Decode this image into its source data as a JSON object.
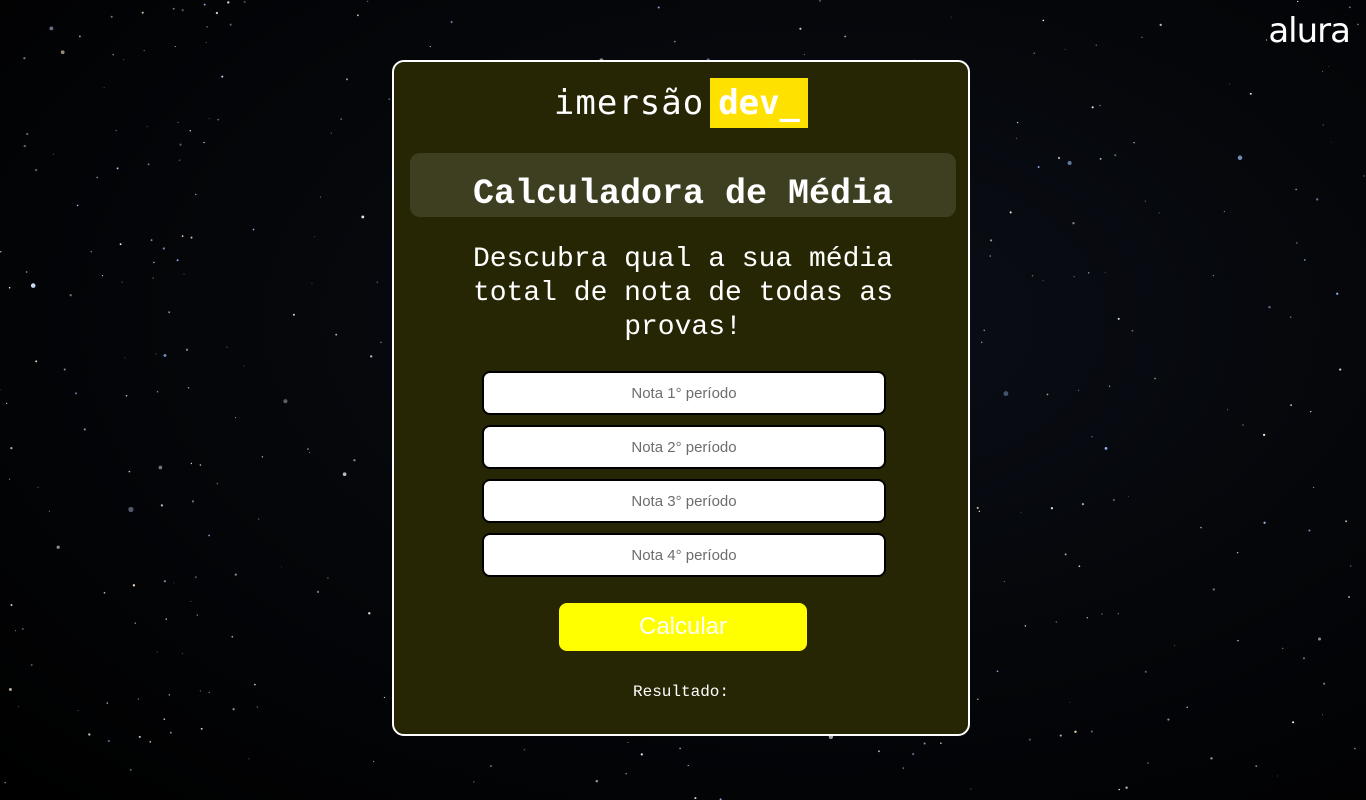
{
  "page": {
    "brand_logo": "alura",
    "background_color": "#000000"
  },
  "card": {
    "border_color": "#ffffff",
    "background_color": "#262604",
    "logo": {
      "word": "imersão",
      "highlight": "dev_",
      "highlight_color": "#ffe100"
    },
    "title": "Calculadora de Média",
    "description": "Descubra qual a sua média total de nota de todas as provas!",
    "inputs": [
      {
        "placeholder": "Nota 1° período",
        "value": ""
      },
      {
        "placeholder": "Nota 2° período",
        "value": ""
      },
      {
        "placeholder": "Nota 3° período",
        "value": ""
      },
      {
        "placeholder": "Nota 4° período",
        "value": ""
      }
    ],
    "button": {
      "label": "Calcular",
      "color": "#ffff00"
    },
    "result_label": "Resultado:"
  }
}
